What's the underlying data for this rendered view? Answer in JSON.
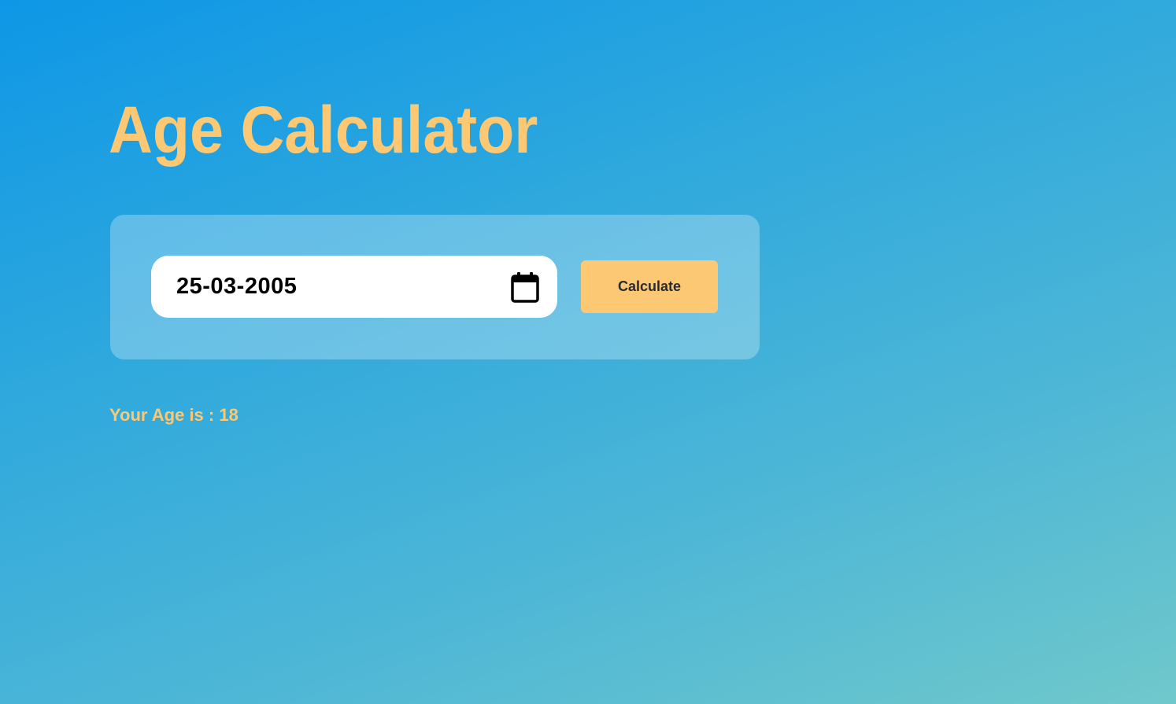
{
  "header": {
    "title": "Age Calculator"
  },
  "form": {
    "date_value": "25-03-2005",
    "calendar_icon": "calendar-icon",
    "button_label": "Calculate"
  },
  "result": {
    "prefix": "Your Age is : ",
    "age": "18"
  },
  "colors": {
    "accent": "#fcc873",
    "gradient_start": "#0e97e6",
    "gradient_end": "#6fc8cb"
  }
}
